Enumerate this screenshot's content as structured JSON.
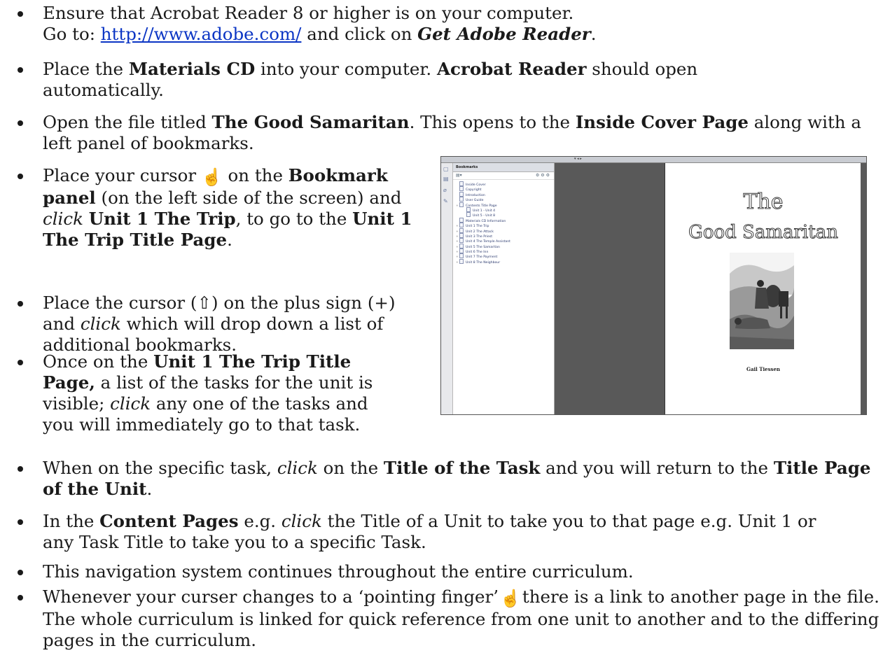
{
  "bullets": [
    {
      "line1": "Ensure that Acrobat Reader 8 or higher is on your computer.",
      "goto": "Go to: ",
      "link": "http://www.adobe.com/",
      "and_click": " and click on ",
      "get_reader": "Get Adobe Reader",
      "end": "."
    },
    {
      "p1": "Place the ",
      "materials_cd": "Materials CD",
      "p2": " into your computer. ",
      "acrobat_reader": "Acrobat Reader",
      "p3": " should open automatically."
    },
    {
      "p1": "Open the file titled ",
      "good_samaritan": "The Good Samaritan",
      "p2": ". This opens to the ",
      "inside_cover": "Inside Cover Page",
      "p3": " along with a left panel of bookmarks."
    },
    {
      "p1": "Place your cursor ",
      "p2": " on the ",
      "bookmark_panel": "Bookmark panel",
      "p3": " (on the left side of the screen) and ",
      "click": "click",
      "p4": " ",
      "unit1_trip": "Unit 1 The Trip",
      "p5": ", to go to the ",
      "unit1_title_page": "Unit 1 The Trip Title Page",
      "p6": "."
    },
    {
      "p1": "Place the cursor (⇧) on the plus sign (+) and ",
      "click": "click",
      "p2": " which will drop down a list of additional bookmarks."
    },
    {
      "p1": "Once on the ",
      "unit1_title_page": "Unit 1 The Trip Title Page,",
      "p2": " a list of the tasks for the unit is visible; ",
      "click": "click",
      "p3": " any one of the tasks and you will immediately go to that task."
    },
    {
      "p1": "When on the specific task, ",
      "click": "click",
      "p2": " on the ",
      "title_of_task": "Title of the Task",
      "p3": " and you will return to the ",
      "title_page_unit": "Title Page of the Unit",
      "p4": "."
    },
    {
      "p1": "In the ",
      "content_pages": "Content Pages",
      "p2": " e.g. ",
      "click": "click",
      "p3": " the Title of a Unit to take you to that page e.g. Unit 1 or any Task Title to take you to a specific Task."
    },
    {
      "p1": "This navigation system continues throughout the entire curriculum."
    },
    {
      "p1": "Whenever your curser changes to a ‘pointing finger’",
      "p2": "there is a link to another page in the file. The whole curriculum is linked for quick reference from one unit to another and to the differing pages in the curriculum."
    }
  ],
  "icons": {
    "hand_cursor": "pointing-hand-icon",
    "hand_glyph": "☝"
  },
  "screenshot": {
    "panel_title": "Bookmarks",
    "bookmarks": [
      {
        "label": "Inside Cover",
        "expandable": false
      },
      {
        "label": "Copyright",
        "expandable": false
      },
      {
        "label": "Introduction",
        "expandable": false
      },
      {
        "label": "User Guide",
        "expandable": false
      },
      {
        "label": "Contents Title Page",
        "expandable": true
      },
      {
        "label": "Unit 1 - Unit 4",
        "expandable": false,
        "indent": true
      },
      {
        "label": "Unit 5 - Unit 8",
        "expandable": false,
        "indent": true
      },
      {
        "label": "Materials CD Information",
        "expandable": false
      },
      {
        "label": "Unit 1 The Trip",
        "expandable": true
      },
      {
        "label": "Unit 2 The Attack",
        "expandable": true
      },
      {
        "label": "Unit 3 The Priest",
        "expandable": true
      },
      {
        "label": "Unit 4 The Temple Assistant",
        "expandable": true
      },
      {
        "label": "Unit 5 The Samaritan",
        "expandable": true
      },
      {
        "label": "Unit 6 The Inn",
        "expandable": true
      },
      {
        "label": "Unit 7 The Payment",
        "expandable": true
      },
      {
        "label": "Unit 8 The Neighbour",
        "expandable": true
      }
    ],
    "book_title_line1": "The",
    "book_title_line2": "Good Samaritan",
    "author": "Gail Tiessen"
  }
}
